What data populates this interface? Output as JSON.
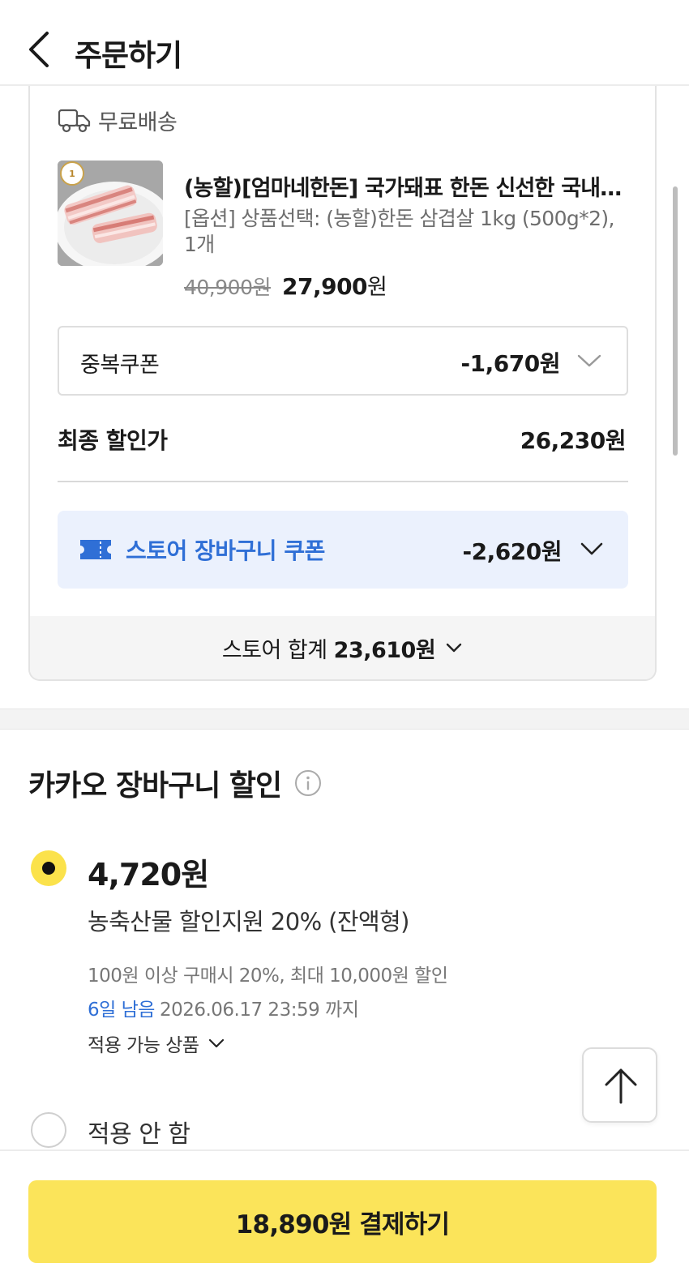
{
  "header": {
    "title": "주문하기"
  },
  "store": {
    "shipping_label": "무료배송",
    "product": {
      "name": "(농할)[엄마네한돈] 국가돼표 한돈 신선한 국내산 삼겹살",
      "option": "[옵션] 상품선택: (농할)한돈 삼겹살 1kg (500g*2), 1개",
      "original_price": "40,900원",
      "sale_price": "27,900",
      "sale_unit": "원"
    },
    "coupon": {
      "label": "중복쿠폰",
      "amount": "-1,670원"
    },
    "final": {
      "label": "최종 할인가",
      "value": "26,230원"
    },
    "store_coupon": {
      "label": "스토어 장바구니 쿠폰",
      "amount": "-2,620원"
    },
    "total": {
      "label": "스토어 합계",
      "value": "23,610원"
    }
  },
  "kakao_discount": {
    "title": "카카오 장바구니 할인",
    "option": {
      "amount": "4,720원",
      "name": "농축산물 할인지원 20% (잔액형)",
      "condition": "100원 이상 구매시 20%, 최대 10,000원 할인",
      "days_left": "6일 남음",
      "expiry": "2026.06.17 23:59 까지",
      "applicable_label": "적용 가능 상품"
    },
    "no_apply_label": "적용 안 함"
  },
  "pay_button": {
    "label": "18,890원 결제하기"
  },
  "colors": {
    "accent_yellow": "#fbe45a",
    "link_blue": "#2f6fd6",
    "coupon_bg": "#ebf1fd"
  }
}
